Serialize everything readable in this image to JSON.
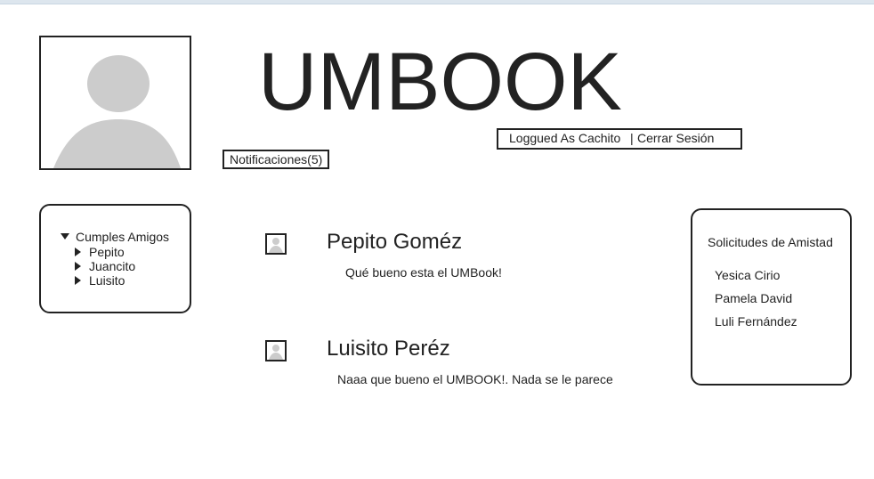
{
  "header": {
    "title": "UMBOOK",
    "session": {
      "logged_label": "Loggued As Cachito",
      "separator": "|",
      "logout_label": "Cerrar Sesión"
    },
    "notifications_label": "Notificaciones(5)"
  },
  "birthdays": {
    "title": "Cumples Amigos",
    "items": [
      "Pepito",
      "Juancito",
      "Luisito"
    ]
  },
  "posts": [
    {
      "author": "Pepito Goméz",
      "text": "Qué bueno esta el UMBook!"
    },
    {
      "author": "Luisito Peréz",
      "text": "Naaa que bueno el UMBOOK!. Nada se le parece"
    }
  ],
  "friend_requests": {
    "title": "Solicitudes de Amistad",
    "items": [
      "Yesica Cirio",
      "Pamela David",
      "Luli Fernández"
    ]
  },
  "colors": {
    "border": "#222222",
    "placeholder": "#cccccc",
    "topbar": "#dde6ee"
  },
  "icons": {
    "profile": "user-silhouette-icon",
    "tree_expanded": "triangle-down-icon",
    "tree_collapsed": "triangle-right-icon"
  }
}
